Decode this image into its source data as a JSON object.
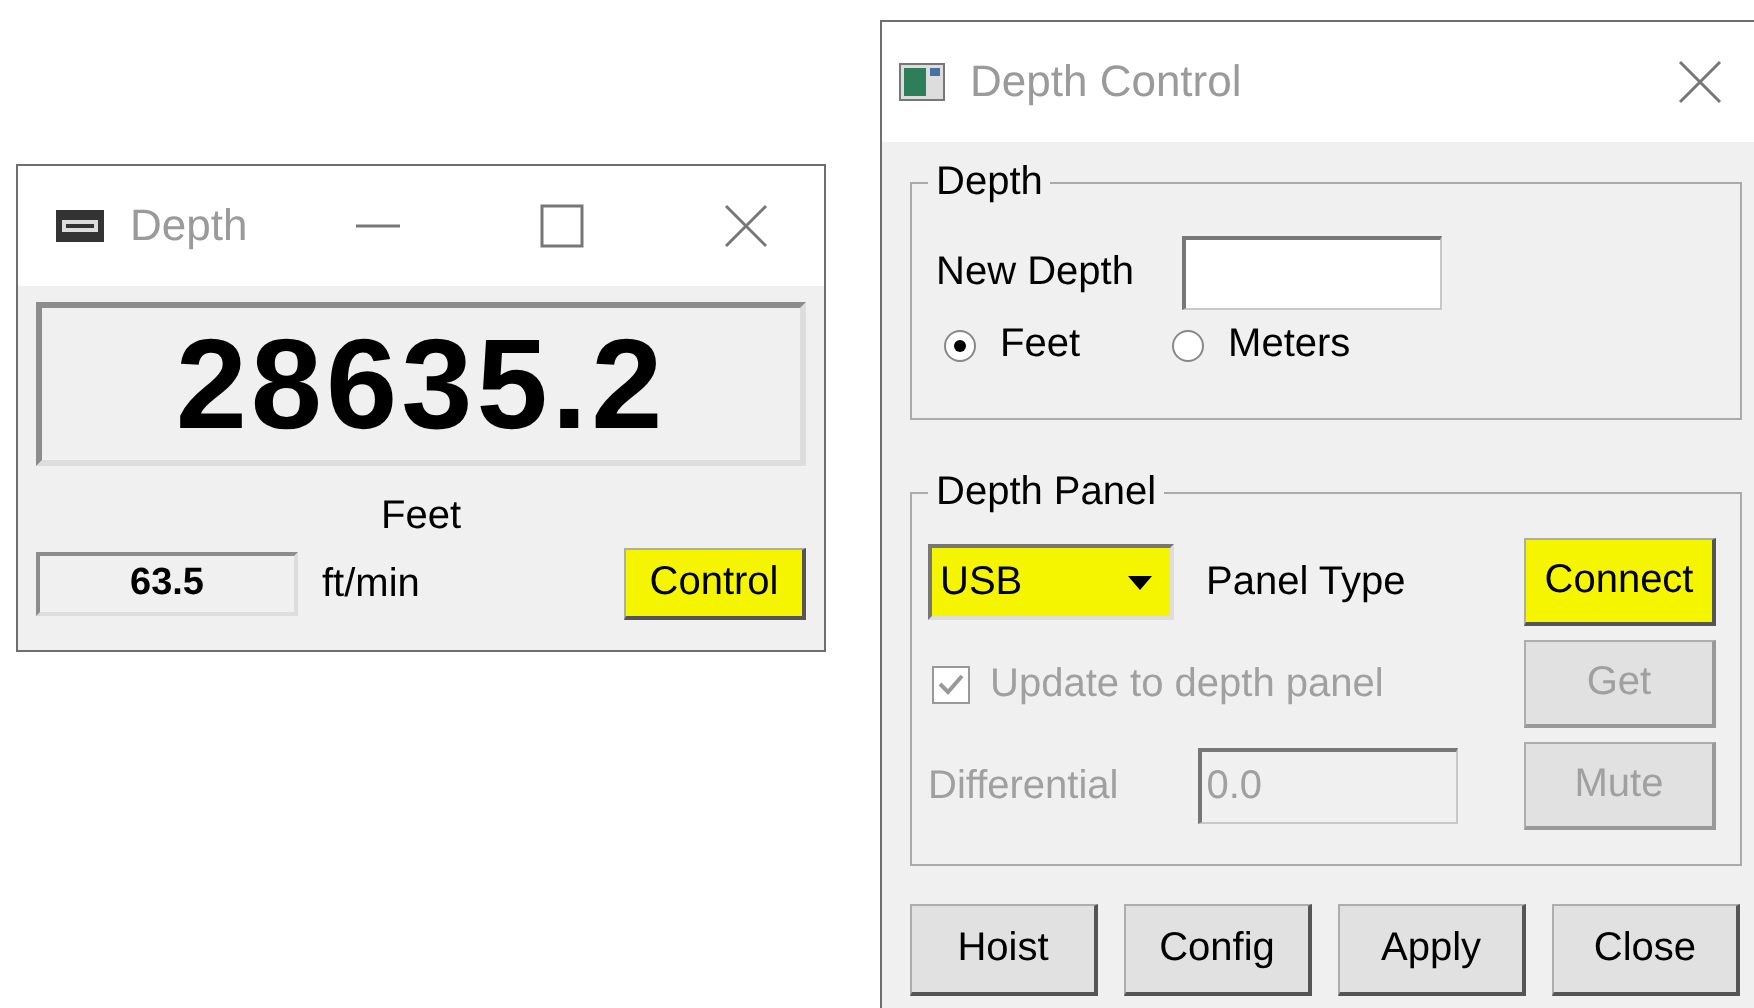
{
  "depth_window": {
    "title": "Depth",
    "depth_value": "28635.2",
    "unit": "Feet",
    "rate": "63.5",
    "rate_unit": "ft/min",
    "control_button": {
      "label": "Control",
      "highlighted": true
    }
  },
  "control_window": {
    "title": "Depth Control",
    "depth_group": {
      "title": "Depth",
      "new_depth_label": "New Depth",
      "radios": [
        {
          "label": "Feet",
          "selected": true
        },
        {
          "label": "Meters",
          "selected": false
        }
      ]
    },
    "panel_group": {
      "title": "Depth Panel",
      "panel_type": {
        "value": "USB",
        "highlighted": true
      },
      "panel_type_label": "Panel Type",
      "update_checkbox": {
        "label": "Update to depth panel",
        "checked": true,
        "disabled": true
      },
      "differential": {
        "label": "Differential",
        "value": "0.0",
        "disabled": true
      },
      "buttons": [
        {
          "label": "Connect",
          "disabled": false,
          "highlighted": true
        },
        {
          "label": "Get",
          "disabled": true,
          "highlighted": false
        },
        {
          "label": "Mute",
          "disabled": true,
          "highlighted": false
        }
      ]
    },
    "buttons": [
      {
        "label": "Hoist",
        "highlighted": false
      },
      {
        "label": "Config",
        "highlighted": false
      },
      {
        "label": "Apply",
        "highlighted": false
      },
      {
        "label": "Close",
        "highlighted": false
      }
    ]
  }
}
